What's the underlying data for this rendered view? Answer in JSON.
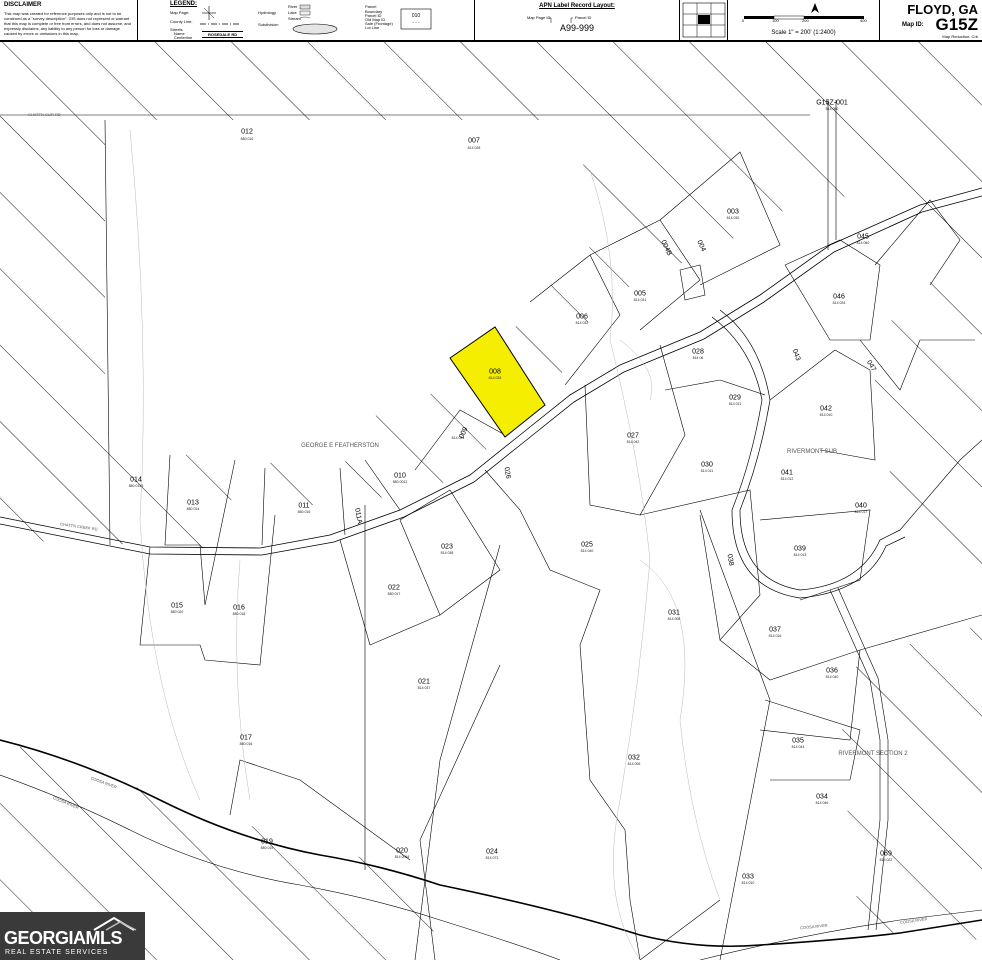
{
  "header": {
    "disclaimer_title": "DISCLAIMER",
    "disclaimer_text": "This map was created for reference purposes only and is not to be construed as a \"survey description\". GIS does not represent or warrant that this map is complete or free from errors, and does not assume, and expressly disclaims, any liability to any person for loss or damage caused by errors or omissions in this map.",
    "legend_title": "LEGEND:",
    "legend_items": [
      "Map Page:",
      "County Line:",
      "Streets",
      "Name",
      "Centerline"
    ],
    "legend_street_sample": "ROSEDALE RD",
    "hydrology_label": "Hydrology",
    "hydrology_items": [
      "River",
      "Lake",
      "Stream"
    ],
    "subdivision_label": "Subdivision",
    "parcel_label": "Parcel",
    "parcel_items": [
      "Boundary",
      "Parcel ID",
      "Old Map ID",
      "Sale (Frontage)",
      "Lot Line"
    ],
    "apn_title": "APN Label Record Layout:",
    "apn_map_page_id": "Map Page ID",
    "apn_parcel_id": "Parcel ID",
    "apn_example": "A99-999",
    "scale_ticks": [
      "0",
      "100",
      "200",
      "400"
    ],
    "scale_text": "Scale 1\" = 200' (1:2400)",
    "county": "FLOYD, GA",
    "map_id_label": "Map ID:",
    "map_id": "G15Z",
    "map_reduction": "Map Reduction: Crb"
  },
  "map": {
    "highlight_color": "#f5ee00",
    "parcels": [
      {
        "id": "012",
        "sub": "880 016"
      },
      {
        "id": "007",
        "sub": "814 028"
      },
      {
        "id": "003",
        "sub": "814 030"
      },
      {
        "id": "005",
        "sub": "814 031"
      },
      {
        "id": "006",
        "sub": "814 032"
      },
      {
        "id": "008",
        "sub": "814 033"
      },
      {
        "id": "009",
        "sub": "814 034"
      },
      {
        "id": "010",
        "sub": "880 0012"
      },
      {
        "id": "011",
        "sub": "880 016"
      },
      {
        "id": "011A",
        "sub": ""
      },
      {
        "id": "013",
        "sub": "880 014"
      },
      {
        "id": "014",
        "sub": "880 0145"
      },
      {
        "id": "015",
        "sub": "880 020"
      },
      {
        "id": "016",
        "sub": "880 018"
      },
      {
        "id": "017",
        "sub": "880 016"
      },
      {
        "id": "019",
        "sub": "880 019"
      },
      {
        "id": "020",
        "sub": "814 0054"
      },
      {
        "id": "021",
        "sub": "814 037"
      },
      {
        "id": "022",
        "sub": "880 017"
      },
      {
        "id": "023",
        "sub": "814 038"
      },
      {
        "id": "024",
        "sub": "814 073"
      },
      {
        "id": "025",
        "sub": "814 040"
      },
      {
        "id": "027",
        "sub": "814 042"
      },
      {
        "id": "028",
        "sub": "814 06"
      },
      {
        "id": "029",
        "sub": "814 011"
      },
      {
        "id": "030",
        "sub": "814 011"
      },
      {
        "id": "031",
        "sub": "814 008"
      },
      {
        "id": "032",
        "sub": "814 006"
      },
      {
        "id": "033",
        "sub": "814 010"
      },
      {
        "id": "034",
        "sub": "814 046"
      },
      {
        "id": "035",
        "sub": "814 044"
      },
      {
        "id": "036",
        "sub": "814 040"
      },
      {
        "id": "037",
        "sub": "814 016"
      },
      {
        "id": "038",
        "sub": ""
      },
      {
        "id": "039",
        "sub": "814 013"
      },
      {
        "id": "040",
        "sub": "814 017"
      },
      {
        "id": "041",
        "sub": "814 012"
      },
      {
        "id": "042",
        "sub": "814 010"
      },
      {
        "id": "043",
        "sub": ""
      },
      {
        "id": "045",
        "sub": "814 060"
      },
      {
        "id": "046",
        "sub": "814 024"
      },
      {
        "id": "047",
        "sub": ""
      },
      {
        "id": "069",
        "sub": "814 022"
      },
      {
        "id": "G15Z-001",
        "sub": "814 080"
      },
      {
        "id": "004",
        "sub": ""
      },
      {
        "id": "004B",
        "sub": ""
      },
      {
        "id": "026",
        "sub": ""
      }
    ],
    "area_labels": [
      "GEORGE E FEATHERSTON",
      "RIVERMONT SUB",
      "RIVERMONT SECTION 2"
    ],
    "street_labels": [
      "CHATTN CUR RD",
      "CHATTN CREEK RD",
      "COOSA RIVER",
      "COOSA RIVER"
    ],
    "river_labels": [
      "COOSA RIVER",
      "COOSA RIVER"
    ]
  },
  "logo": {
    "brand": "GEORGIAMLS",
    "tagline": "REAL ESTATE SERVICES"
  }
}
